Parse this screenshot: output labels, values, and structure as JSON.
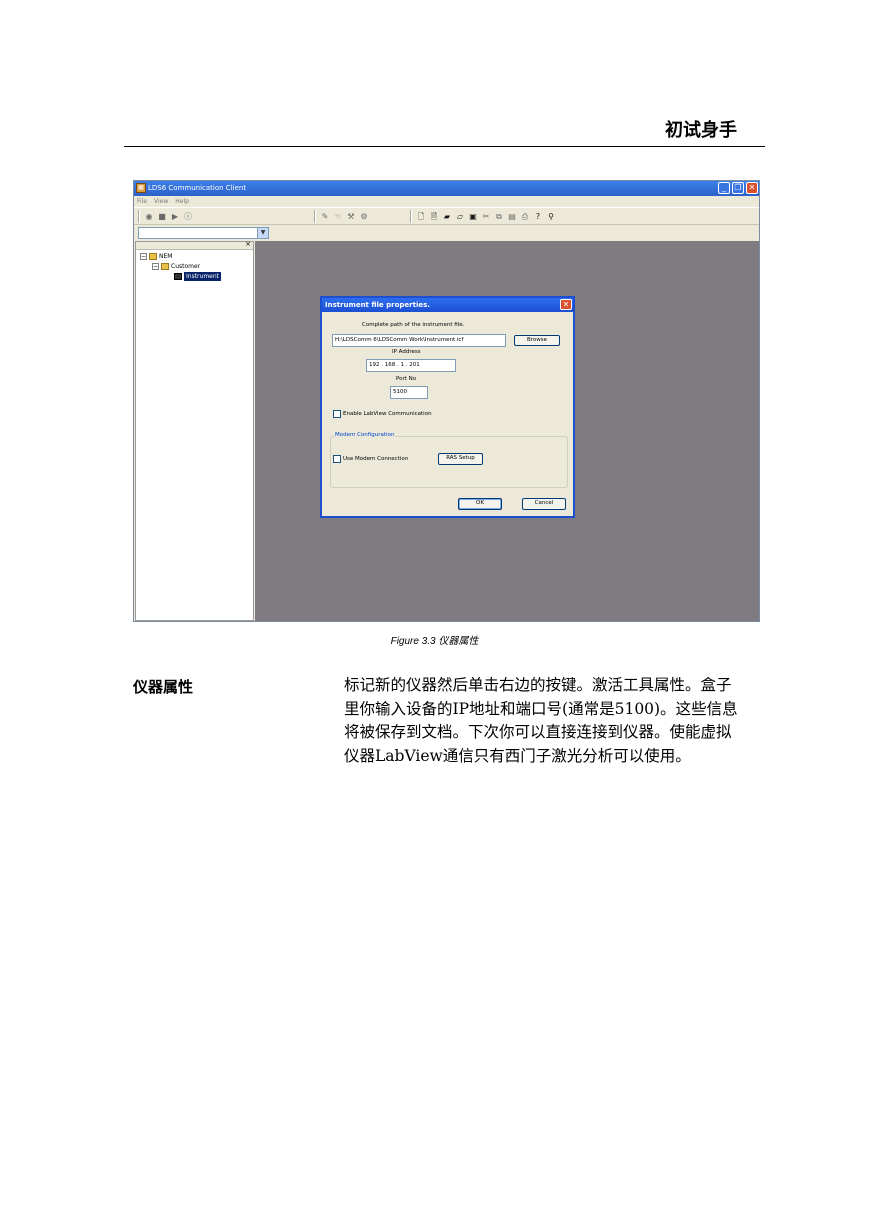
{
  "page": {
    "header_title": "初试身手",
    "figure_caption": "Figure 3.3  仪器属性",
    "section_label": "仪器属性",
    "body_text": "标记新的仪器然后单击右边的按键。激活工具属性。盒子里你输入设备的IP地址和端口号(通常是5100)。这些信息将被保存到文档。下次你可以直接连接到仪器。使能虚拟仪器LabView通信只有西门子激光分析可以使用。"
  },
  "app": {
    "window_title": "LDS6 Communication Client",
    "menu": [
      "File",
      "View",
      "Help"
    ],
    "tree": {
      "root": "NEM",
      "customer": "Customer",
      "instrument": "Instrument"
    }
  },
  "dialog": {
    "title": "Instrument file properties.",
    "path_label": "Complete path of the instrument file.",
    "path_value": "H:\\LDSComm 6\\LDSComm Work\\Instrument.icf",
    "browse_label": "Browse",
    "ip_label": "IP Address",
    "ip_value": "192  .  168  .    1    .  201",
    "port_label": "Port No",
    "port_value": "5100",
    "labview_label": "Enable LabView Communication",
    "modem_group_label": "Modem Configuration",
    "modem_label": "Use Modem Connection",
    "ras_label": "RAS Setup",
    "ok_label": "OK",
    "cancel_label": "Cancel"
  }
}
